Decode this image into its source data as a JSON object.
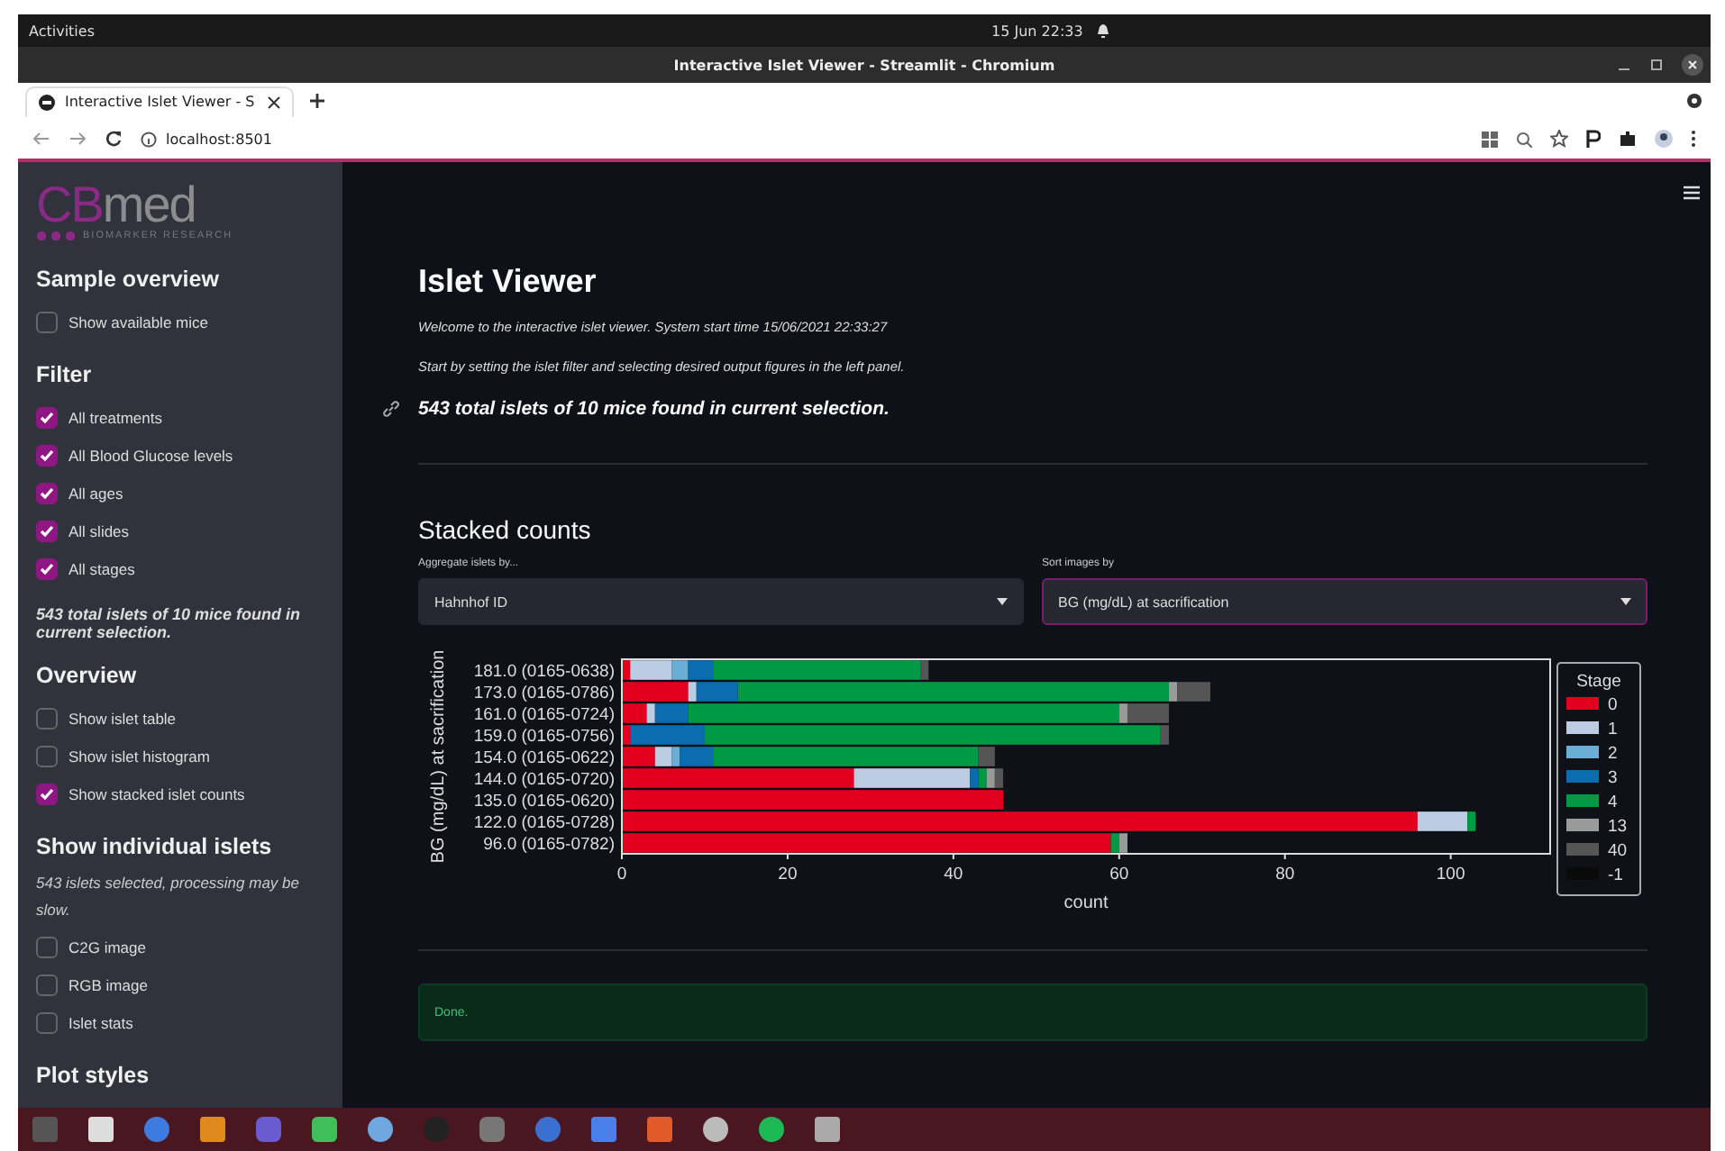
{
  "topbar": {
    "activities": "Activities",
    "clock": "15 Jun  22:33"
  },
  "window": {
    "title": "Interactive Islet Viewer - Streamlit - Chromium"
  },
  "tabs": [
    {
      "label": "Interactive Islet Viewer - S",
      "selected": true
    }
  ],
  "address": "localhost:8501",
  "sidebar": {
    "logo": {
      "mark": "CB",
      "word": "med",
      "tagline": "BIOMARKER RESEARCH"
    },
    "items": [
      {
        "kind": "heading",
        "text": "Sample overview"
      },
      {
        "kind": "checkbox",
        "text": "Show available mice",
        "checked": false
      },
      {
        "kind": "heading",
        "text": "Filter"
      },
      {
        "kind": "checkbox",
        "text": "All treatments",
        "checked": true
      },
      {
        "kind": "checkbox",
        "text": "All Blood Glucose levels",
        "checked": true
      },
      {
        "kind": "checkbox",
        "text": "All ages",
        "checked": true
      },
      {
        "kind": "checkbox",
        "text": "All slides",
        "checked": true
      },
      {
        "kind": "checkbox",
        "text": "All stages",
        "checked": true
      },
      {
        "kind": "summary",
        "text": "543 total islets of 10 mice found in current selection."
      },
      {
        "kind": "heading",
        "text": "Overview"
      },
      {
        "kind": "checkbox",
        "text": "Show islet table",
        "checked": false
      },
      {
        "kind": "checkbox",
        "text": "Show islet histogram",
        "checked": false
      },
      {
        "kind": "checkbox",
        "text": "Show stacked islet counts",
        "checked": true
      },
      {
        "kind": "heading",
        "text": "Show individual islets"
      },
      {
        "kind": "note",
        "text": "543 islets selected, processing may be slow."
      },
      {
        "kind": "checkbox",
        "text": "C2G image",
        "checked": false
      },
      {
        "kind": "checkbox",
        "text": "RGB image",
        "checked": false
      },
      {
        "kind": "checkbox",
        "text": "Islet stats",
        "checked": false
      },
      {
        "kind": "heading",
        "text": "Plot styles"
      }
    ]
  },
  "main": {
    "title": "Islet Viewer",
    "intro": [
      "Welcome to the interactive islet viewer. System start time 15/06/2021 22:33:27",
      "Start by setting the islet filter and selecting desired output figures in the left panel."
    ],
    "summary": "543 total islets of 10 mice found in current selection.",
    "section": "Stacked counts",
    "selects": [
      {
        "label": "Aggregate islets by...",
        "value": "Hahnhof ID",
        "focused": false
      },
      {
        "label": "Sort images by",
        "value": "BG (mg/dL) at sacrification",
        "focused": true
      }
    ],
    "chart_data": {
      "type": "bar",
      "orientation": "horizontal",
      "stacked": true,
      "xlabel": "count",
      "ylabel": "BG (mg/dL) at sacrification",
      "legend": {
        "title": "Stage"
      },
      "categories": [
        "181.0 (0165-0638)",
        "173.0 (0165-0786)",
        "161.0 (0165-0724)",
        "159.0 (0165-0756)",
        "154.0 (0165-0622)",
        "144.0 (0165-0720)",
        "135.0 (0165-0620)",
        "122.0 (0165-0728)",
        "96.0 (0165-0782)"
      ],
      "xlim": [
        0,
        112
      ],
      "xticks": [
        0,
        20,
        40,
        60,
        80,
        100
      ],
      "series": [
        {
          "name": "0",
          "color": "#e3001f",
          "values": [
            1,
            8,
            3,
            1,
            4,
            28,
            46,
            96,
            59
          ]
        },
        {
          "name": "1",
          "color": "#bccde3",
          "values": [
            5,
            1,
            1,
            0,
            2,
            14,
            0,
            6,
            0
          ]
        },
        {
          "name": "2",
          "color": "#6aaed6",
          "values": [
            2,
            0,
            0,
            0,
            1,
            0,
            0,
            0,
            0
          ]
        },
        {
          "name": "3",
          "color": "#0b6cb0",
          "values": [
            3,
            5,
            4,
            9,
            4,
            1,
            0,
            0,
            0
          ]
        },
        {
          "name": "4",
          "color": "#009944",
          "values": [
            25,
            52,
            52,
            55,
            32,
            1,
            0,
            1,
            1
          ]
        },
        {
          "name": "13",
          "color": "#9a9a9a",
          "values": [
            0,
            1,
            1,
            0,
            0,
            1,
            0,
            0,
            1
          ]
        },
        {
          "name": "40",
          "color": "#555555",
          "values": [
            1,
            4,
            5,
            1,
            2,
            1,
            0,
            0,
            0
          ]
        },
        {
          "name": "-1",
          "color": "#0a0a0a",
          "values": [
            0,
            0,
            0,
            0,
            0,
            0,
            0,
            0,
            0
          ]
        }
      ]
    },
    "status": "Done."
  }
}
